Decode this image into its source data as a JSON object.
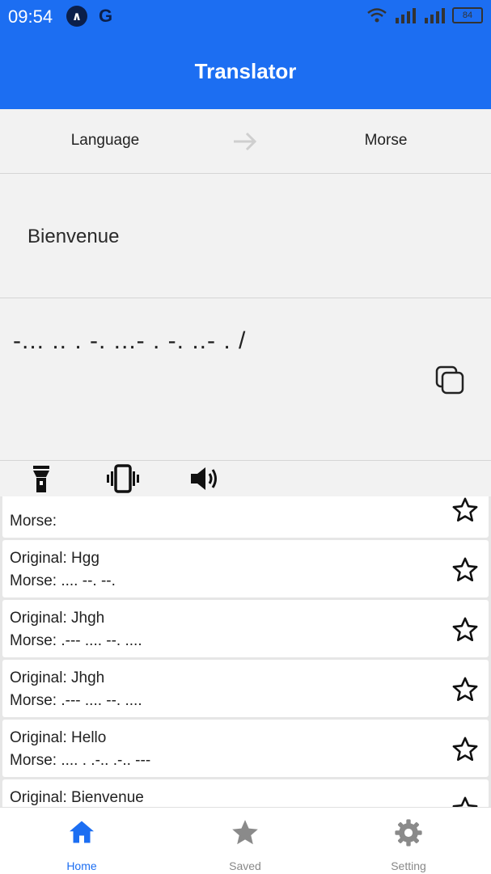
{
  "status_bar": {
    "time": "09:54",
    "battery": "84"
  },
  "app_bar": {
    "title": "Translator"
  },
  "lang": {
    "source": "Language",
    "target": "Morse"
  },
  "input": {
    "text": "Bienvenue"
  },
  "output": {
    "text": "-... .. . -. ...- . -. ..- .  /"
  },
  "history": [
    {
      "original": "",
      "morse": "Morse:"
    },
    {
      "original": "Original: Hgg",
      "morse": "Morse: .... --. --."
    },
    {
      "original": "Original: Jhgh",
      "morse": "Morse: .--- .... --. ...."
    },
    {
      "original": "Original: Jhgh",
      "morse": "Morse: .--- .... --. ...."
    },
    {
      "original": "Original: Hello",
      "morse": "Morse: .... . .-.. .-.. ---"
    },
    {
      "original": "Original: Bienvenue",
      "morse": ""
    }
  ],
  "nav": [
    {
      "label": "Home",
      "icon": "home-icon",
      "active": true
    },
    {
      "label": "Saved",
      "icon": "star-icon",
      "active": false
    },
    {
      "label": "Setting",
      "icon": "gear-icon",
      "active": false
    }
  ],
  "colors": {
    "primary": "#1c6ef2",
    "inactive": "#888888"
  }
}
